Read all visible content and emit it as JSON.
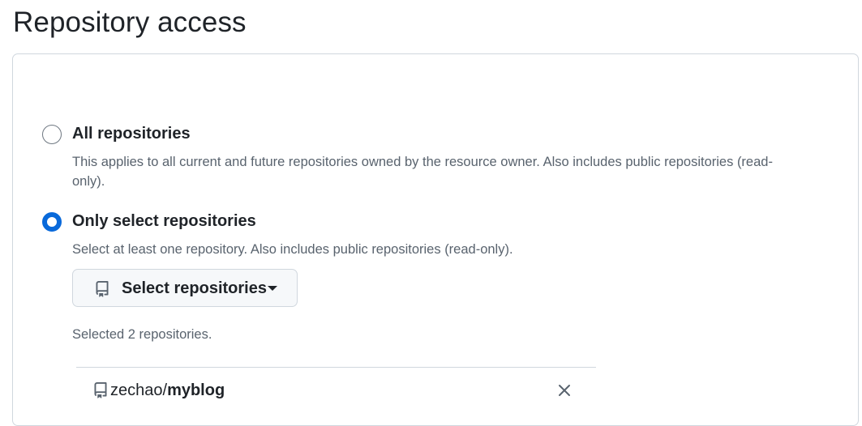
{
  "page": {
    "title": "Repository access"
  },
  "options": [
    {
      "label": "All repositories",
      "description": "This applies to all current and future repositories owned by the resource owner. Also includes public repositories (read-only).",
      "checked": false
    },
    {
      "label": "Only select repositories",
      "description": "Select at least one repository. Also includes public repositories (read-only).",
      "checked": true
    }
  ],
  "select_button": {
    "label": "Select repositories",
    "icon": "repo-icon"
  },
  "selected_summary": "Selected 2 repositories.",
  "repositories": [
    {
      "owner": "zechao/",
      "name": "myblog",
      "icon": "repo-icon",
      "remove_icon": "close-icon"
    }
  ],
  "colors": {
    "accent": "#0969da",
    "border": "#d0d7de",
    "muted_text": "#59636e",
    "text": "#1f2328",
    "button_bg": "#f6f8fa"
  }
}
